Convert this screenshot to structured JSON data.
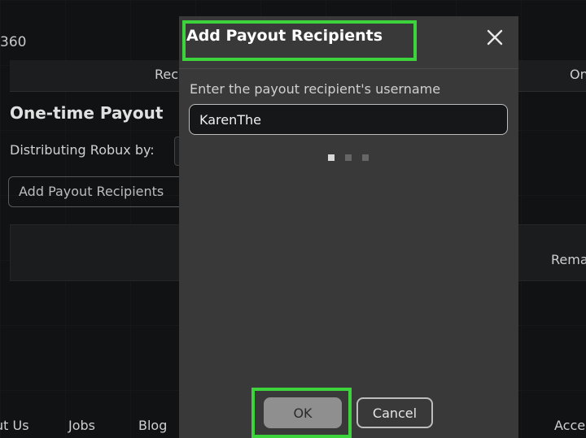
{
  "background": {
    "id_text": "360",
    "tab_left": "Rec",
    "tab_right": "On",
    "section_title": "One-time Payout",
    "distributing_label": "Distributing Robux by:",
    "add_button": "Add Payout Recipients",
    "remaining_label": "Rema",
    "footer": {
      "about": "ut Us",
      "jobs": "Jobs",
      "blog": "Blog",
      "account": "Acce"
    }
  },
  "modal": {
    "title": "Add Payout Recipients",
    "close_icon": "close-icon",
    "prompt": "Enter the payout recipient's username",
    "username_value": "KarenThe",
    "pagination_dots": 3,
    "active_dot": 1,
    "ok_label": "OK",
    "cancel_label": "Cancel"
  },
  "colors": {
    "highlight": "#3cd33c",
    "modal_bg": "#39393a",
    "page_bg": "#111213"
  }
}
